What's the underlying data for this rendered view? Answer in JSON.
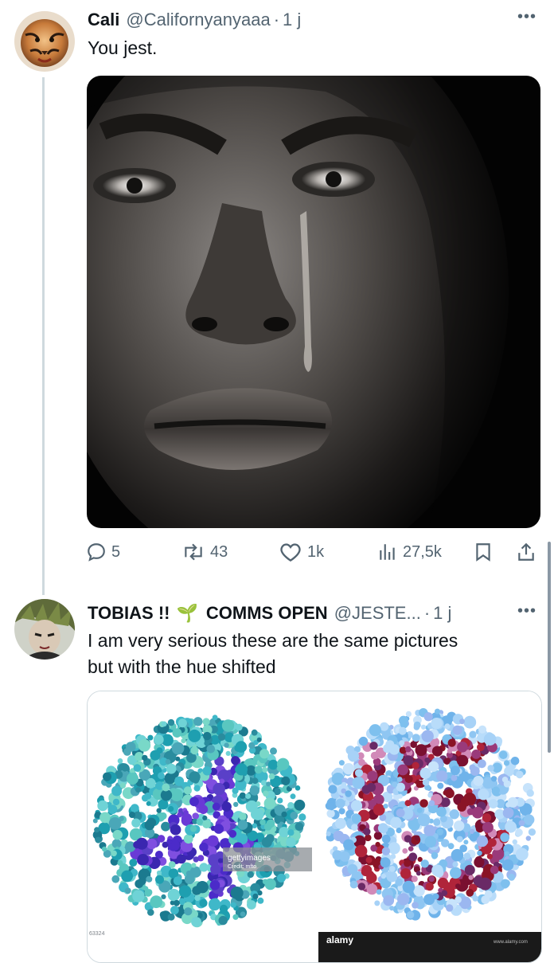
{
  "tweets": [
    {
      "name": "Cali",
      "handle": "@Californyanyaaa",
      "dot": "·",
      "time": "1 j",
      "text": "You jest.",
      "image_alt": "Close-up black and white painting of a woman's face with a tear"
    },
    {
      "name": "TOBIAS !!",
      "emoji": "🌱",
      "name_suffix": "COMMS OPEN",
      "handle": "@JESTE...",
      "dot": "·",
      "time": "1 j",
      "text_line1": "I am very serious these are the same pictures",
      "text_line2": "but with the hue shifted",
      "image_left_watermark": "gettyimages",
      "image_left_credit": "Credit: mfto",
      "image_left_id": "63324",
      "image_right_watermark": "alamy",
      "image_right_small": "www.alamy.com"
    }
  ],
  "actions": {
    "replies": "5",
    "reposts": "43",
    "likes": "1k",
    "views": "27,5k"
  },
  "icons": {
    "more": "ellipsis-icon",
    "reply": "reply-icon",
    "repost": "repost-icon",
    "like": "heart-icon",
    "views": "views-icon",
    "bookmark": "bookmark-icon",
    "share": "share-icon"
  },
  "colors": {
    "text": "#0f1419",
    "secondary": "#536471",
    "divider": "#cfd9de"
  }
}
